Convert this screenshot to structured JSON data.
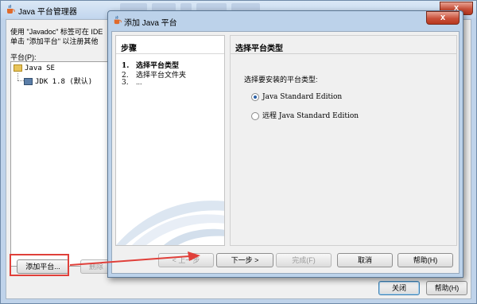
{
  "outer_window": {
    "title": "Java 平台管理器",
    "close_glyph": "x",
    "description_line1": "使用 \"Javadoc\" 标签可在 IDE",
    "description_line2": "单击 \"添加平台\" 以注册其他",
    "platform_label": "平台(P):",
    "tree": {
      "root": "Java SE",
      "child": "JDK 1.8 (默认)"
    },
    "buttons": {
      "add_platform": "添加平台...",
      "remove": "删除",
      "close": "关闭",
      "help": "帮助(H)"
    }
  },
  "dialog": {
    "title": "添加 Java 平台",
    "close_glyph": "x",
    "steps_header": "步骤",
    "steps": [
      {
        "num": "1.",
        "label": "选择平台类型"
      },
      {
        "num": "2.",
        "label": "选择平台文件夹"
      },
      {
        "num": "3.",
        "label": "..."
      }
    ],
    "main_header": "选择平台类型",
    "prompt": "选择要安装的平台类型:",
    "options": [
      {
        "label": "Java Standard Edition",
        "checked": true
      },
      {
        "label": "远程 Java Standard Edition",
        "checked": false
      }
    ],
    "buttons": {
      "back": "< 上一步",
      "next": "下一步 >",
      "finish": "完成(F)",
      "cancel": "取消",
      "help": "帮助(H)"
    }
  },
  "colors": {
    "annotation_red": "#e0403a",
    "accent_blue": "#2a5fa5"
  }
}
